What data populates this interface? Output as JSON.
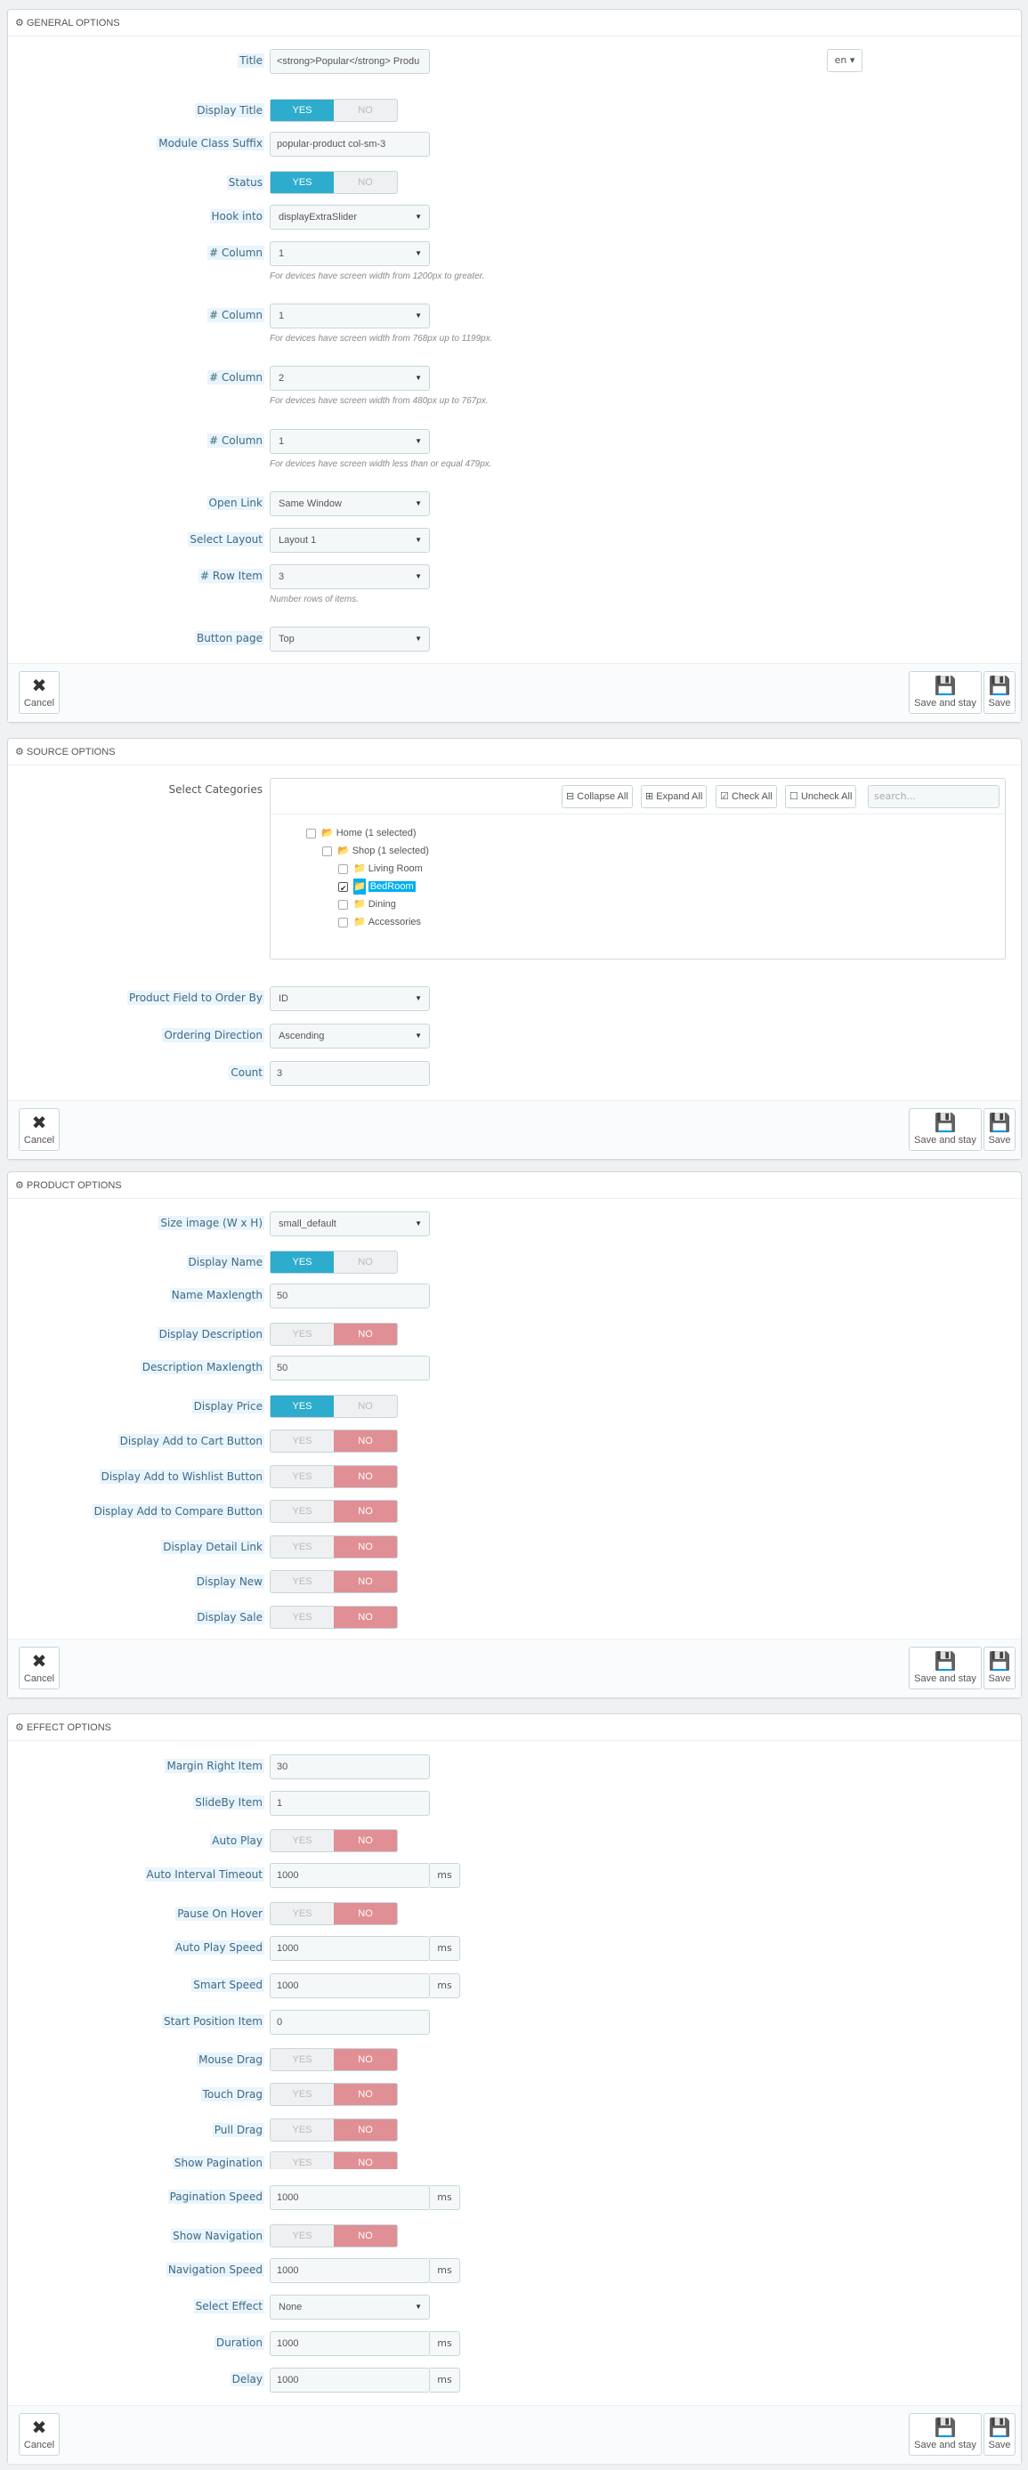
{
  "icons": {
    "gears": "gears-icon",
    "save": "save-icon",
    "cancel": "close-icon"
  },
  "buttons": {
    "cancel": "Cancel",
    "save_and_stay": "Save and stay",
    "save": "Save"
  },
  "switch_labels": {
    "yes": "YES",
    "no": "NO"
  },
  "general": {
    "heading": "GENERAL OPTIONS",
    "title": {
      "label": "Title",
      "value": "<strong>Popular</strong> Produ",
      "lang": "en"
    },
    "display_title": {
      "label": "Display Title",
      "value": "YES"
    },
    "module_class_suffix": {
      "label": "Module Class Suffix",
      "value": "popular-product col-sm-3"
    },
    "status": {
      "label": "Status",
      "value": "YES"
    },
    "hook_into": {
      "label": "Hook into",
      "value": "displayExtraSlider"
    },
    "columns": [
      {
        "label": "# Column",
        "value": "1",
        "help": "For devices have screen width from 1200px to greater."
      },
      {
        "label": "# Column",
        "value": "1",
        "help": "For devices have screen width from 768px up to 1199px."
      },
      {
        "label": "# Column",
        "value": "2",
        "help": "For devices have screen width from 480px up to 767px."
      },
      {
        "label": "# Column",
        "value": "1",
        "help": "For devices have screen width less than or equal 479px."
      }
    ],
    "open_link": {
      "label": "Open Link",
      "value": "Same Window"
    },
    "select_layout": {
      "label": "Select Layout",
      "value": "Layout 1"
    },
    "row_item": {
      "label": "# Row Item",
      "value": "3",
      "help": "Number rows of items."
    },
    "button_page": {
      "label": "Button page",
      "value": "Top"
    }
  },
  "source": {
    "heading": "SOURCE OPTIONS",
    "select_categories": {
      "label": "Select Categories"
    },
    "tree_toolbar": {
      "collapse": "Collapse All",
      "expand": "Expand All",
      "check": "Check All",
      "uncheck": "Uncheck All",
      "search_placeholder": "search..."
    },
    "tree": [
      {
        "label": "Home (1 selected)",
        "checked": false,
        "highlighted": false
      },
      {
        "label": "Shop (1 selected)",
        "checked": false,
        "highlighted": false
      },
      {
        "label": "Living Room",
        "checked": false,
        "highlighted": false
      },
      {
        "label": "BedRoom",
        "checked": true,
        "highlighted": true
      },
      {
        "label": "Dining",
        "checked": false,
        "highlighted": false
      },
      {
        "label": "Accessories",
        "checked": false,
        "highlighted": false
      }
    ],
    "order_by": {
      "label": "Product Field to Order By",
      "value": "ID"
    },
    "ordering_direction": {
      "label": "Ordering Direction",
      "value": "Ascending"
    },
    "count": {
      "label": "Count",
      "value": "3"
    }
  },
  "product": {
    "heading": "PRODUCT OPTIONS",
    "size_image": {
      "label": "Size image (W x H)",
      "value": "small_default"
    },
    "display_name": {
      "label": "Display Name",
      "value": "YES"
    },
    "name_maxlength": {
      "label": "Name Maxlength",
      "value": "50"
    },
    "display_description": {
      "label": "Display Description",
      "value": "NO"
    },
    "description_maxlength": {
      "label": "Description Maxlength",
      "value": "50"
    },
    "display_price": {
      "label": "Display Price",
      "value": "YES"
    },
    "display_add_to_cart": {
      "label": "Display Add to Cart Button",
      "value": "NO"
    },
    "display_add_to_wishlist": {
      "label": "Display Add to Wishlist Button",
      "value": "NO"
    },
    "display_add_to_compare": {
      "label": "Display Add to Compare Button",
      "value": "NO"
    },
    "display_detail_link": {
      "label": "Display Detail Link",
      "value": "NO"
    },
    "display_new": {
      "label": "Display New",
      "value": "NO"
    },
    "display_sale": {
      "label": "Display Sale",
      "value": "NO"
    }
  },
  "effect": {
    "heading": "EFFECT OPTIONS",
    "unit": "ms",
    "margin_right_item": {
      "label": "Margin Right Item",
      "value": "30"
    },
    "slideby_item": {
      "label": "SlideBy Item",
      "value": "1"
    },
    "auto_play": {
      "label": "Auto Play",
      "value": "NO"
    },
    "auto_interval_timeout": {
      "label": "Auto Interval Timeout",
      "value": "1000"
    },
    "pause_on_hover": {
      "label": "Pause On Hover",
      "value": "NO"
    },
    "auto_play_speed": {
      "label": "Auto Play Speed",
      "value": "1000"
    },
    "smart_speed": {
      "label": "Smart Speed",
      "value": "1000"
    },
    "start_position_item": {
      "label": "Start Position Item",
      "value": "0"
    },
    "mouse_drag": {
      "label": "Mouse Drag",
      "value": "NO"
    },
    "touch_drag": {
      "label": "Touch Drag",
      "value": "NO"
    },
    "pull_drag": {
      "label": "Pull Drag",
      "value": "NO"
    },
    "show_pagination": {
      "label": "Show Pagination",
      "value": "NO"
    },
    "pagination_speed": {
      "label": "Pagination Speed",
      "value": "1000"
    },
    "show_navigation": {
      "label": "Show Navigation",
      "value": "NO"
    },
    "navigation_speed": {
      "label": "Navigation Speed",
      "value": "1000"
    },
    "select_effect": {
      "label": "Select Effect",
      "value": "None"
    },
    "duration": {
      "label": "Duration",
      "value": "1000"
    },
    "delay": {
      "label": "Delay",
      "value": "1000"
    }
  }
}
